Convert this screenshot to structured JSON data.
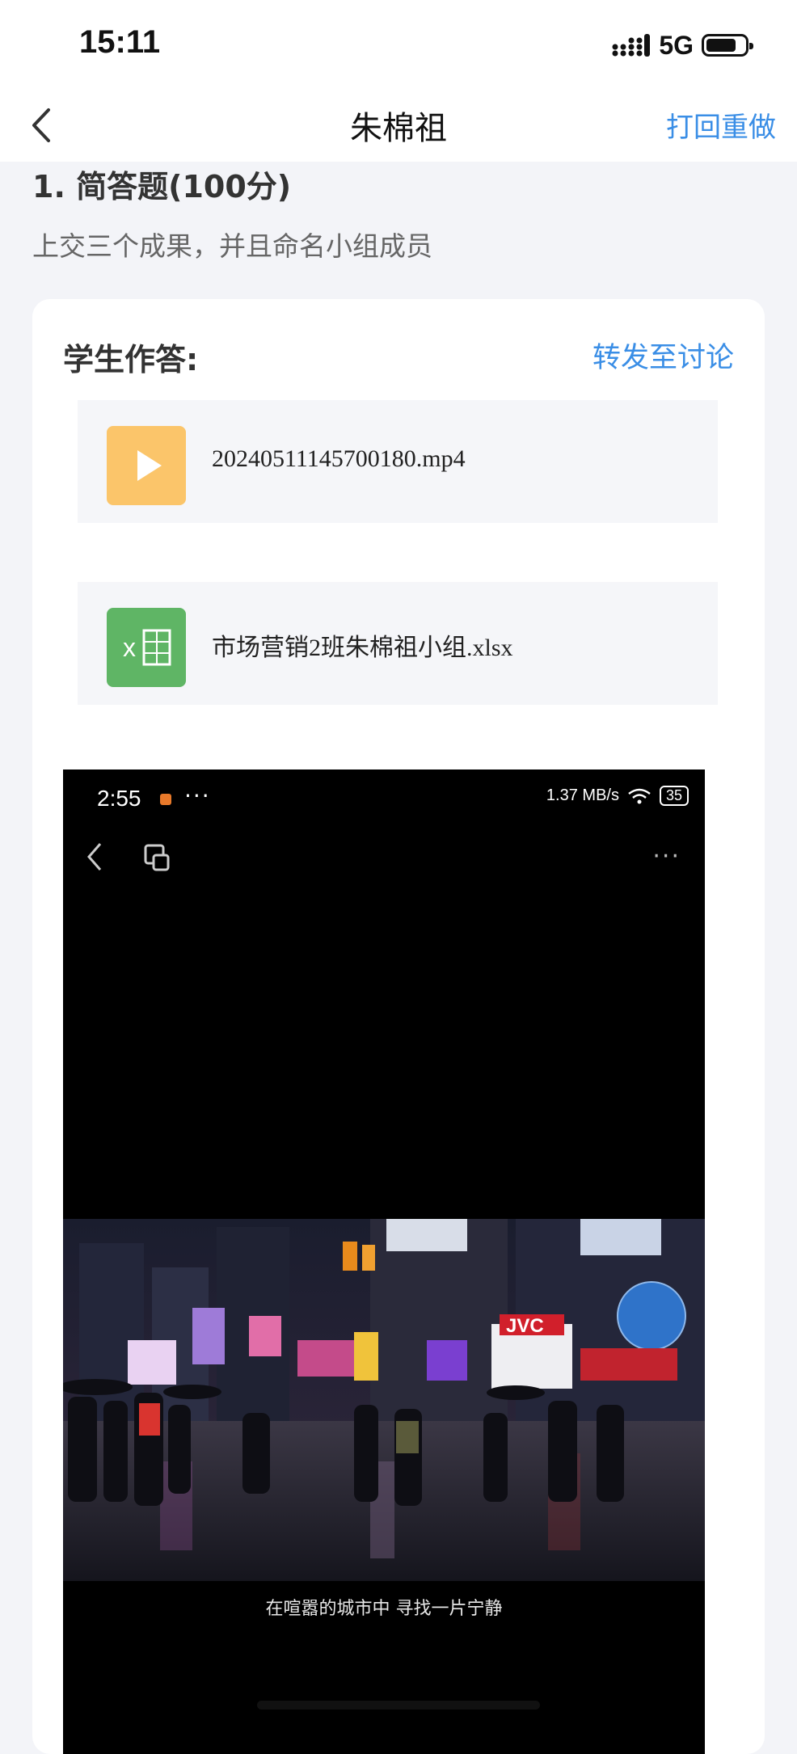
{
  "status_bar": {
    "time": "15:11",
    "network": "5G"
  },
  "nav": {
    "title": "朱棉祖",
    "action": "打回重做"
  },
  "question": {
    "title": "1. 简答题(100分)",
    "description": "上交三个成果，并且命名小组成员"
  },
  "answer": {
    "label": "学生作答:",
    "forward_label": "转发至讨论",
    "files": [
      {
        "name": "20240511145700180.mp4",
        "icon": "video-play-icon"
      },
      {
        "name": "市场营销2班朱棉祖小组.xlsx",
        "icon": "excel-icon"
      }
    ]
  },
  "screenshot": {
    "time": "2:55",
    "dots": "···",
    "speed": "1.37 MB/s",
    "battery": "35",
    "menu": "···",
    "subtitle": "在喧嚣的城市中 寻找一片宁静",
    "sign_text": "JVC"
  },
  "colors": {
    "accent": "#3a8ee6",
    "video_icon": "#fbc56a",
    "excel_icon": "#5fb565",
    "card_bg": "#ffffff",
    "page_bg": "#f3f4f8"
  }
}
